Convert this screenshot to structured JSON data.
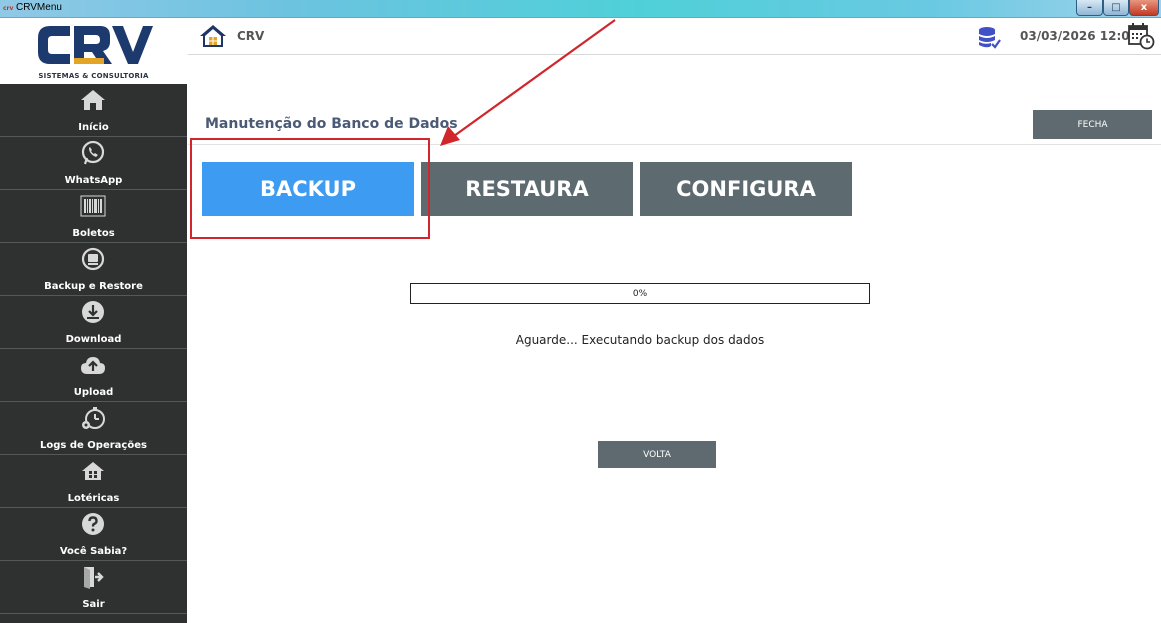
{
  "window": {
    "title": "CRVMenu",
    "app_icon_text": "crv",
    "controls": {
      "minimize": "–",
      "maximize": "□",
      "close": "x"
    }
  },
  "logo": {
    "text": "CRV",
    "subtitle": "SISTEMAS & CONSULTORIA"
  },
  "sidebar": {
    "items": [
      {
        "label": "Início",
        "icon": "home-icon"
      },
      {
        "label": "WhatsApp",
        "icon": "whatsapp-icon"
      },
      {
        "label": "Boletos",
        "icon": "barcode-icon"
      },
      {
        "label": "Backup e Restore",
        "icon": "backup-restore-icon"
      },
      {
        "label": "Download",
        "icon": "download-icon"
      },
      {
        "label": "Upload",
        "icon": "upload-icon"
      },
      {
        "label": "Logs de Operações",
        "icon": "logs-icon"
      },
      {
        "label": "Lotéricas",
        "icon": "loterica-icon"
      },
      {
        "label": "Você Sabia?",
        "icon": "question-icon"
      },
      {
        "label": "Sair",
        "icon": "exit-icon"
      }
    ]
  },
  "header": {
    "brand": "CRV",
    "datetime": "03/03/2026 12:06"
  },
  "main": {
    "title": "Manutenção do Banco de Dados",
    "close_label": "FECHA",
    "actions": {
      "backup": "BACKUP",
      "restaura": "RESTAURA",
      "configura": "CONFIGURA"
    },
    "progress": {
      "percent": 0,
      "label": "0%"
    },
    "status": "Aguarde... Executando backup dos dados",
    "back_label": "VOLTA"
  },
  "colors": {
    "sidebar_bg": "#2f3030",
    "primary_blue": "#3d9cf2",
    "button_gray": "#5d6a70",
    "annotation_red": "#d0262c",
    "logo_blue": "#1d3a6e",
    "logo_gold": "#e2a526"
  }
}
